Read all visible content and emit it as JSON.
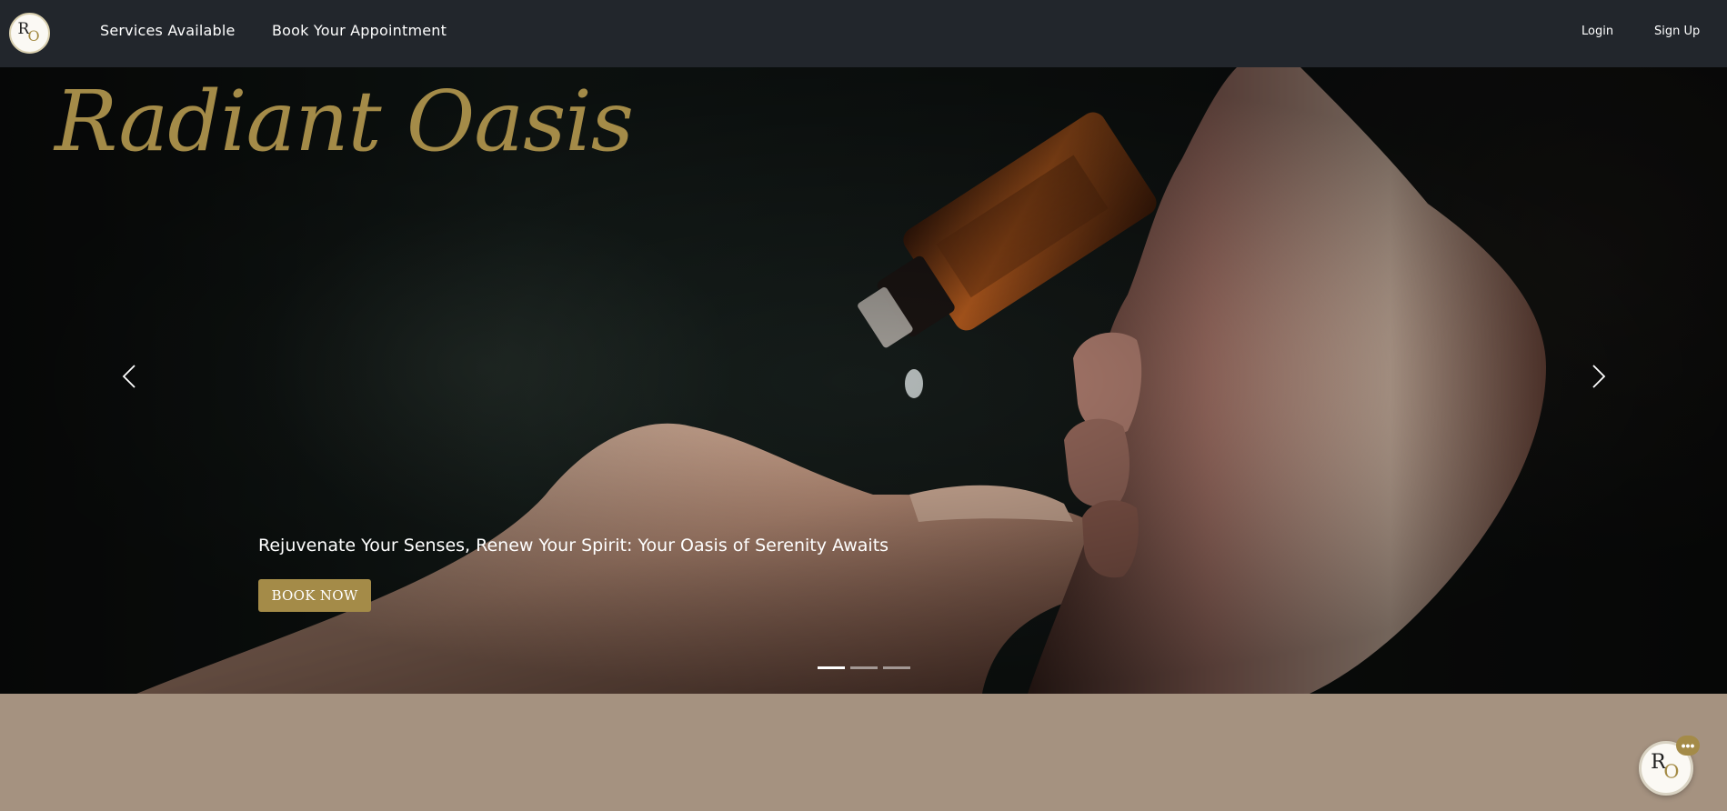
{
  "navbar": {
    "logo_primary": "R",
    "logo_secondary": "O",
    "links": [
      "Services Available",
      "Book Your Appointment"
    ],
    "auth": {
      "login": "Login",
      "signup": "Sign Up"
    }
  },
  "hero": {
    "title": "Radiant Oasis",
    "tagline": "Rejuvenate Your Senses, Renew Your Spirit: Your Oasis of Serenity Awaits",
    "cta": "BOOK NOW",
    "carousel": {
      "prev_icon": "chevron-left-icon",
      "next_icon": "chevron-right-icon",
      "slide_count": 3,
      "active_slide": 1
    }
  },
  "chat": {
    "logo_primary": "R",
    "logo_secondary": "O",
    "badge": "•••"
  },
  "colors": {
    "navbar": "#22262c",
    "accent_gold": "#a48b48",
    "page_background": "#a59280"
  }
}
